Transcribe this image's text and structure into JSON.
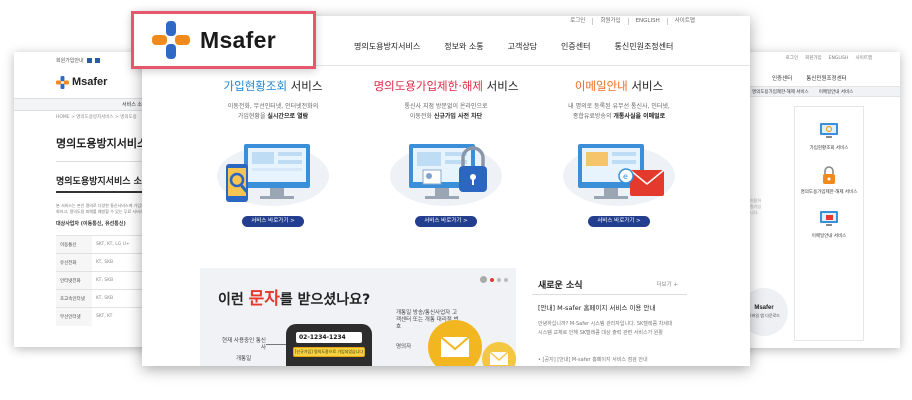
{
  "back_left": {
    "utility_text": "회원가입안내",
    "brand": "Msafer",
    "menu_label": "서비스 소개",
    "breadcrumb": "HOME  >  명의도용방지서비스  >  명의도용",
    "page_title": "명의도용방지서비스",
    "section_title": "명의도용방지서비스 소개",
    "description": "본 서비스는 본인 명의로 다양한 통신서비스에 가입된 현황을 조회하고, 명의도용 피해를 예방할 수 있는 무료 서비스입니다.",
    "sub_heading": "대상사업자 (이동통신, 유선통신)",
    "rows": [
      {
        "key": "이동통신",
        "value": "SKT, KT, LG U+"
      },
      {
        "key": "유선전화",
        "value": "KT, SKB"
      },
      {
        "key": "인터넷전화",
        "value": "KT, SKB"
      },
      {
        "key": "초고속인터넷",
        "value": "KT, SKB"
      },
      {
        "key": "무선인터넷",
        "value": "SKT, KT"
      }
    ]
  },
  "back_right": {
    "top_links": [
      "로그인",
      "회원가입",
      "ENGLISH",
      "사이트맵"
    ],
    "nav": [
      "인증센터",
      "통신민원조정센터"
    ],
    "sub_nav": [
      "명의도용가입제한·해제 서비스",
      "이메일안내 서비스"
    ],
    "side_items": [
      "가입현황조회 서비스",
      "명의도용가입제한·해제 서비스",
      "이메일안내 서비스"
    ],
    "blur_text": "서비스를 이용하시려면 회원가입이 필요합니다.",
    "ad_title": "Msafer",
    "ad_sub": "모바일 앱 다운로드"
  },
  "main": {
    "brand": "Msafer",
    "util_links": [
      "로그인",
      "회원가입",
      "ENGLISH",
      "사이트맵"
    ],
    "gnb": [
      "명의도용방지서비스",
      "정보와 소통",
      "고객상담",
      "인증센터",
      "통신민원조정센터"
    ],
    "services": [
      {
        "title_accent": "가입현황조회",
        "title_rest": " 서비스",
        "desc_line1": "이동전화, 무선인터넷, 인터넷전화의",
        "desc_line2_plain": "가입현황을 ",
        "desc_line2_bold": "실시간으로 열람",
        "button": "서비스 바로가기 >"
      },
      {
        "title_accent": "명의도용가입제한·해제",
        "title_rest": " 서비스",
        "desc_line1": "통신사 지점 방문없이 온라인으로",
        "desc_line2_plain": "이동전화 ",
        "desc_line2_bold": "신규가입 사전 차단",
        "button": "서비스 바로가기 >"
      },
      {
        "title_accent": "이메일안내",
        "title_rest": " 서비스",
        "desc_line1": "내 명의로 등록된 유무선 통신사, 인터넷,",
        "desc_line2_plain": "종합유료방송의 ",
        "desc_line2_bold": "개통사실을 이메일로",
        "button": "서비스 바로가기 >"
      }
    ],
    "banner": {
      "headline_pre": "이런 ",
      "headline_red": "문자",
      "headline_post": "를 받으셨나요?",
      "phone_number": "02-1234-1234",
      "message": "[신규가입] 명의도용으로 가입되었습니다",
      "label_left_top": "현재 사용중인 통신사",
      "label_left_bottom": "개통일",
      "label_right_top": "개통일 방송/통신사업자 고객센터 또는 개통 대리점 번호",
      "label_right_mid": "명의자"
    },
    "news": {
      "title": "새로운 소식",
      "more": "더보기 +",
      "headline": "[안내] M-safer 홈페이지 서비스 이용 안내",
      "body": "안녕하십니까? M-Safer 시스템 관리자입니다. SK텔레콤 차세대 시스템 교체로 인해 SK텔레콤 대상 출력 관련 서비스가 원활",
      "list_item": "• [공지] [안내] M-safer 홈페이지 서비스 점검 안내"
    }
  },
  "colors": {
    "highlight": "#e8566b",
    "blue": "#1f86d6",
    "red": "#e02a49",
    "orange": "#ee6d21",
    "navy_button": "#233e8e"
  }
}
